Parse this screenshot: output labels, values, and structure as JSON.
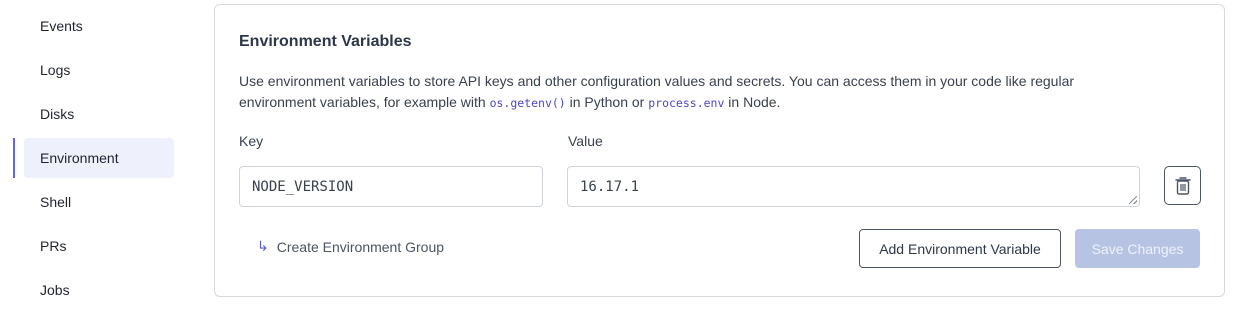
{
  "sidebar": {
    "items": [
      {
        "label": "Events"
      },
      {
        "label": "Logs"
      },
      {
        "label": "Disks"
      },
      {
        "label": "Environment"
      },
      {
        "label": "Shell"
      },
      {
        "label": "PRs"
      },
      {
        "label": "Jobs"
      }
    ],
    "active": "Environment"
  },
  "env_card": {
    "title": "Environment Variables",
    "desc_part1": "Use environment variables to store API keys and other configuration values and secrets. You can access them in your code like regular environment variables, for example with ",
    "code_python": "os.getenv()",
    "desc_part2": " in Python or ",
    "code_node": "process.env",
    "desc_part3": " in Node.",
    "key_label": "Key",
    "value_label": "Value",
    "row": {
      "key": "NODE_VERSION",
      "value": "16.17.1"
    },
    "create_group_label": "Create Environment Group",
    "add_button_label": "Add Environment Variable",
    "save_button_label": "Save Changes"
  },
  "icons": {
    "delete": "trash-icon",
    "create_group": "return-arrow-icon"
  },
  "colors": {
    "accent": "#6366d6",
    "active_bg": "#eef0fb",
    "save_disabled": "#b6c3e3",
    "code": "#4f46c8"
  }
}
